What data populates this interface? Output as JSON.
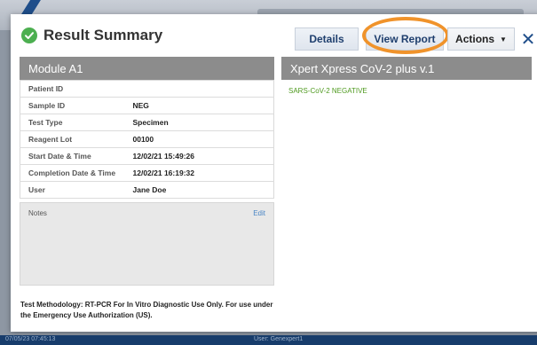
{
  "dialog": {
    "title": "Result Summary",
    "buttons": {
      "details": "Details",
      "view_report": "View Report",
      "actions": "Actions"
    },
    "close_symbol": "✕"
  },
  "module": {
    "header": "Module A1",
    "rows": [
      {
        "label": "Patient ID",
        "value": ""
      },
      {
        "label": "Sample ID",
        "value": "NEG"
      },
      {
        "label": "Test Type",
        "value": "Specimen"
      },
      {
        "label": "Reagent Lot",
        "value": "00100"
      },
      {
        "label": "Start Date & Time",
        "value": "12/02/21 15:49:26"
      },
      {
        "label": "Completion Date & Time",
        "value": "12/02/21 16:19:32"
      },
      {
        "label": "User",
        "value": "Jane Doe"
      }
    ],
    "notes_label": "Notes",
    "notes_edit": "Edit",
    "methodology": "Test Methodology: RT-PCR For In Vitro Diagnostic Use Only. For use under the Emergency Use Authorization (US)."
  },
  "assay": {
    "header": "Xpert Xpress CoV-2 plus v.1",
    "result": "SARS-CoV-2 NEGATIVE"
  },
  "status_bar": {
    "timestamp": "07/05/23 07:45:13",
    "user": "User: Genexpert1"
  },
  "colors": {
    "highlight": "#f0932b",
    "success": "#4caf50",
    "result_text": "#4f9a1f"
  }
}
